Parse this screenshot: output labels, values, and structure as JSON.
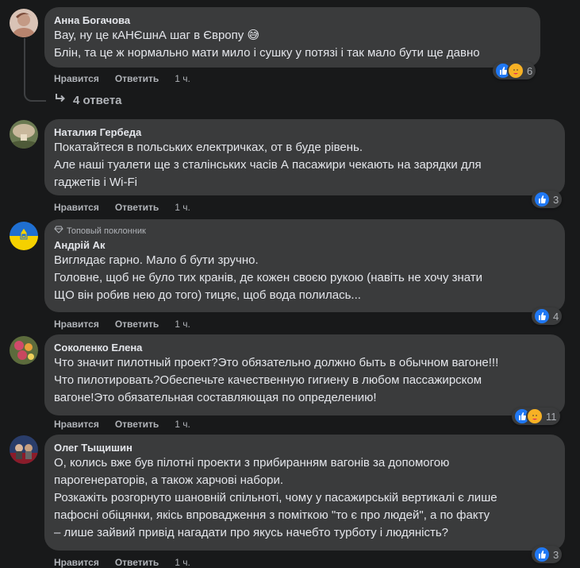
{
  "action_labels": {
    "like": "Нравится",
    "reply": "Ответить"
  },
  "replies_link": {
    "label": "4 ответа"
  },
  "comments": [
    {
      "author": "Анна Богачова",
      "lines": [
        "Вау, ну це кАНЄшнА шаг в Європу 😅",
        "Блін, та це ж нормально мати мило і сушку у потязі і так мало бути ще давно"
      ],
      "time": "1 ч.",
      "reaction_count": "6",
      "reactions": [
        "like-icon",
        "care-icon"
      ]
    },
    {
      "author": "Наталия Гербеда",
      "lines": [
        "Покатайтеся в польських електричках, от в буде рівень.",
        "Але наші туалети ще з сталінських часів А пасажири чекають на зарядки для",
        "гаджетів і Wi-Fi"
      ],
      "time": "1 ч.",
      "reaction_count": "3",
      "reactions": [
        "like-icon"
      ]
    },
    {
      "badge": "Топовый поклонник",
      "author": "Андрій Ак",
      "lines": [
        "Виглядає гарно. Мало б бути зручно.",
        "Головне, щоб не було тих кранів, де кожен своєю рукою (навіть не хочу знати",
        "ЩО він робив нею до того) тицяє, щоб вода полилась..."
      ],
      "time": "1 ч.",
      "reaction_count": "4",
      "reactions": [
        "like-icon"
      ]
    },
    {
      "author": "Соколенко Елена",
      "lines": [
        "Что значит пилотный проект?Это обязательно должно быть в обычном вагоне!!!",
        "Что пилотировать?Обеспечьте качественную гигиену в любом пассажирском",
        "вагоне!Это обязательная составляющая по определению!"
      ],
      "time": "1 ч.",
      "reaction_count": "11",
      "reactions": [
        "like-icon",
        "care-icon"
      ]
    },
    {
      "author": "Олег Тыщишин",
      "lines": [
        "О, колись вже був пілотні проекти з прибиранням вагонів за допомогою",
        "парогенераторів, а також харчові набори.",
        "Розкажіть розгорнуто шановній спільноті, чому у пасажирській вертикалі є лише",
        "пафосні обіцянки, якісь впровадження з поміткою \"то є про людей\", а по факту",
        "– лише зайвий привід нагадати про якусь начебто турботу і людяність?"
      ],
      "time": "1 ч.",
      "reaction_count": "3",
      "reactions": [
        "like-icon"
      ]
    }
  ]
}
